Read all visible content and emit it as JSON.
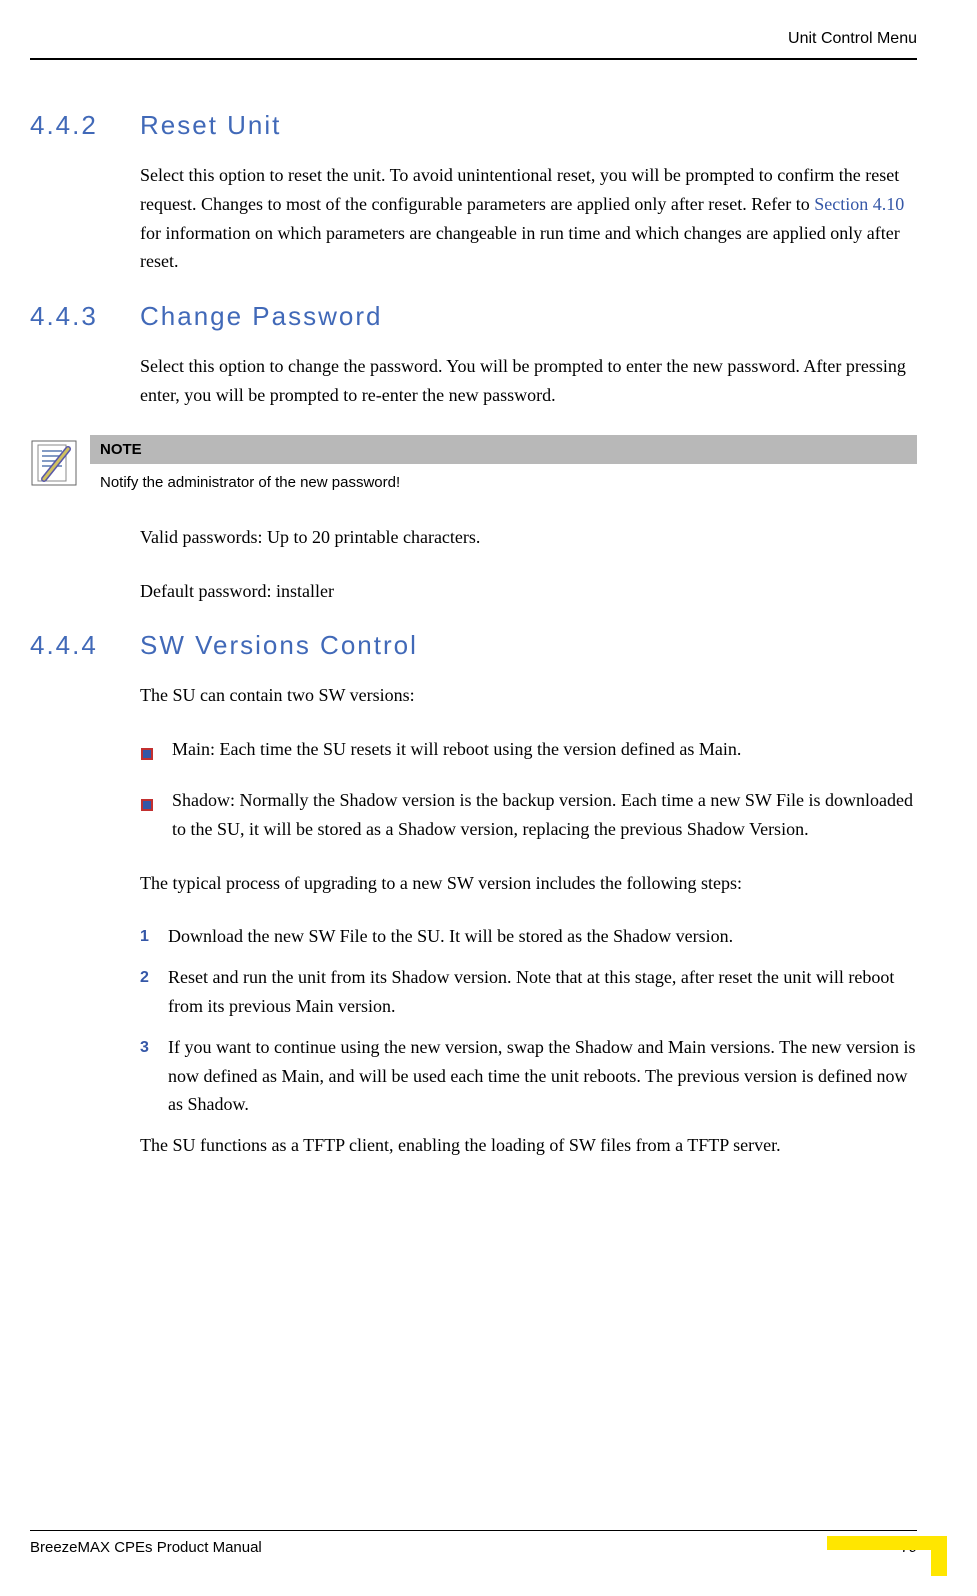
{
  "header": {
    "breadcrumb": "Unit Control Menu"
  },
  "sections": [
    {
      "number": "4.4.2",
      "title": "Reset Unit",
      "para1_a": "Select this option to reset the unit. To avoid unintentional reset, you will be prompted to confirm the reset request. Changes to most of the configurable parameters are applied only after reset. Refer to ",
      "para1_link": "Section 4.10",
      "para1_b": " for information on which parameters are changeable in run time and which changes are applied only after reset."
    },
    {
      "number": "4.4.3",
      "title": "Change Password",
      "para1": "Select this option to change the password. You will be prompted to enter the new password. After pressing enter, you will be prompted to re-enter the new password.",
      "note_label": "NOTE",
      "note_text": "Notify the administrator of the new password!",
      "para2": "Valid passwords: Up to 20 printable characters.",
      "para3": "Default password: installer"
    },
    {
      "number": "4.4.4",
      "title": "SW Versions Control",
      "intro": "The SU can contain two SW versions:",
      "bullets": [
        "Main: Each time the SU resets it will reboot using the version defined as Main.",
        "Shadow: Normally the Shadow version is the backup version. Each time a new SW File is downloaded to the SU, it will be stored as a Shadow version, replacing the previous Shadow Version."
      ],
      "steps_intro": "The typical process of upgrading to a new SW version includes the following steps:",
      "steps": [
        {
          "n": "1",
          "t": "Download the new SW File to the SU. It will be stored as the Shadow version."
        },
        {
          "n": "2",
          "t": "Reset and run the unit from its Shadow version. Note that at this stage, after reset the unit will reboot from its previous Main version."
        },
        {
          "n": "3",
          "t": "If you want to continue using the new version, swap the Shadow and Main versions. The new version is now defined as Main, and will be used each time the unit reboots. The previous version is defined now as Shadow."
        }
      ],
      "outro": "The SU functions as a TFTP client, enabling the loading of SW files from a TFTP server."
    }
  ],
  "footer": {
    "manual": "BreezeMAX CPEs Product Manual",
    "page": "79"
  }
}
